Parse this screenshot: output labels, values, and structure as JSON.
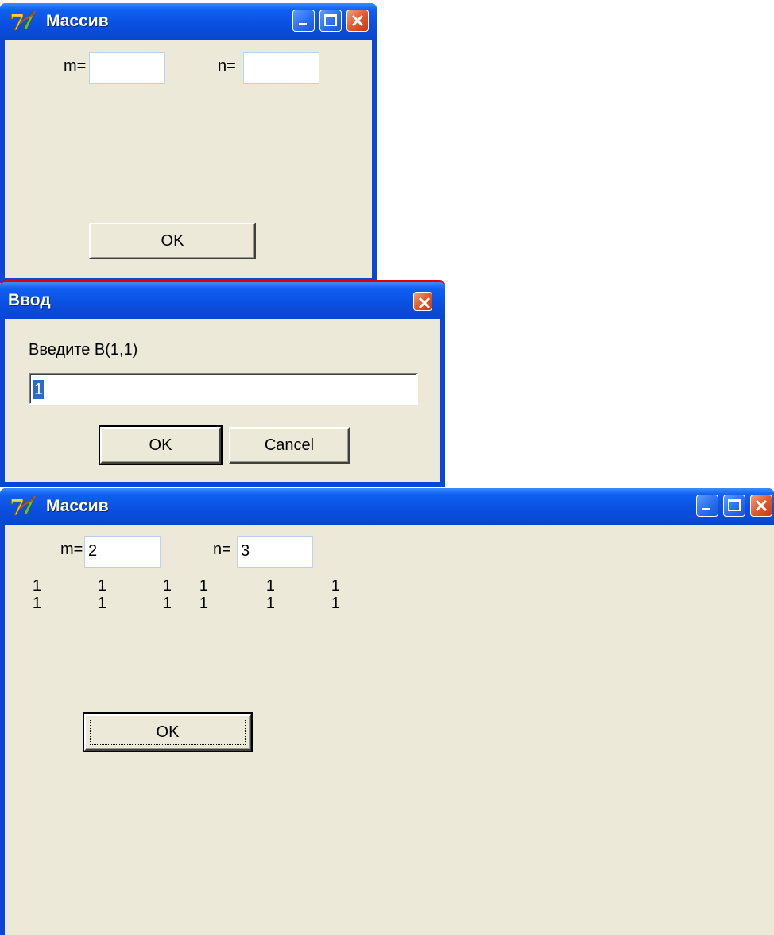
{
  "colors": {
    "titlebar": "#0a4fe0",
    "client": "#ece9d8",
    "close_button": "#e35a2c",
    "selection": "#316ac5"
  },
  "window1": {
    "title": "Массив",
    "icon": "delphi-app-icon",
    "labels": {
      "m": "m=",
      "n": "n="
    },
    "m_value": "",
    "n_value": "",
    "ok_label": "OK"
  },
  "dialog": {
    "title": "Ввод",
    "prompt": "Введите B(1,1)",
    "input_value": "1",
    "ok_label": "OK",
    "cancel_label": "Cancel"
  },
  "window2": {
    "title": "Массив",
    "icon": "delphi-app-icon",
    "labels": {
      "m": "m=",
      "n": "n="
    },
    "m_value": "2",
    "n_value": "3",
    "matrix_rows": [
      [
        "1",
        "1",
        "1",
        "1",
        "1",
        "1"
      ],
      [
        "1",
        "1",
        "1",
        "1",
        "1",
        "1"
      ]
    ],
    "ok_label": "OK"
  }
}
